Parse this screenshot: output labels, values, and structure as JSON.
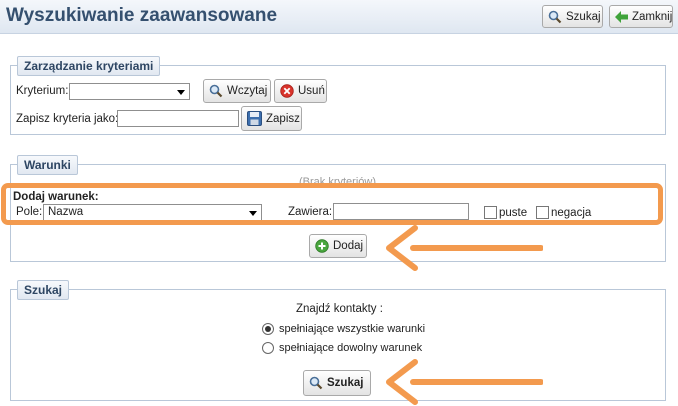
{
  "header": {
    "title": "Wyszukiwanie zaawansowane",
    "search_label": "Szukaj",
    "close_label": "Zamknij"
  },
  "criteria": {
    "legend": "Zarządzanie kryteriami",
    "criterion_label": "Kryterium:",
    "criterion_value": "",
    "load_label": "Wczytaj",
    "delete_label": "Usuń",
    "save_as_label": "Zapisz kryteria jako:",
    "save_as_value": "",
    "save_label": "Zapisz"
  },
  "conditions": {
    "legend": "Warunki",
    "empty_text": "(Brak kryteriów)",
    "add_heading": "Dodaj warunek:",
    "field_label": "Pole:",
    "field_value": "Nazwa",
    "contains_label": "Zawiera:",
    "contains_value": "",
    "empty_checkbox_label": "puste",
    "negation_label": "negacja",
    "add_label": "Dodaj"
  },
  "search": {
    "legend": "Szukaj",
    "find_label": "Znajdź kontakty :",
    "option_all": "spełniające wszystkie warunki",
    "option_any": "spełniające dowolny warunek",
    "selected_option": "all",
    "search_label": "Szukaj"
  },
  "annotation": {
    "highlight_color": "#f39a4e"
  }
}
